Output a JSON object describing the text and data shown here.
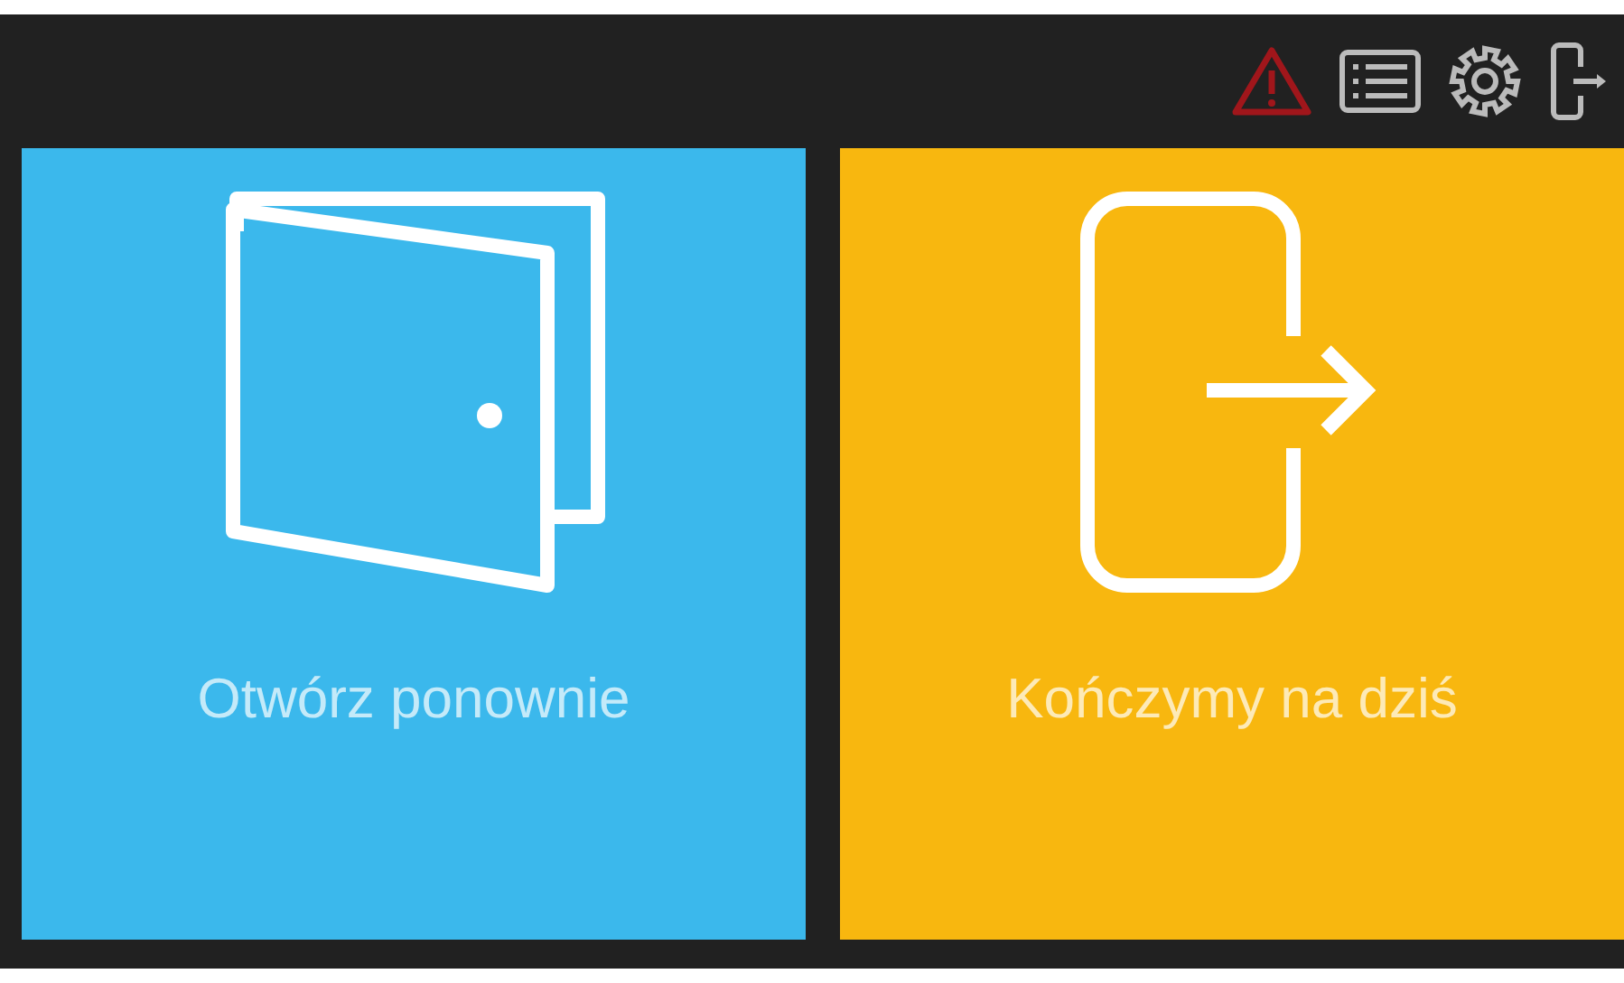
{
  "tiles": [
    {
      "kind": "door",
      "label": "Otwórz ponownie",
      "color": "#3bb8ec"
    },
    {
      "kind": "exit",
      "label": "Kończymy na dziś",
      "color": "#f8b70f"
    }
  ]
}
